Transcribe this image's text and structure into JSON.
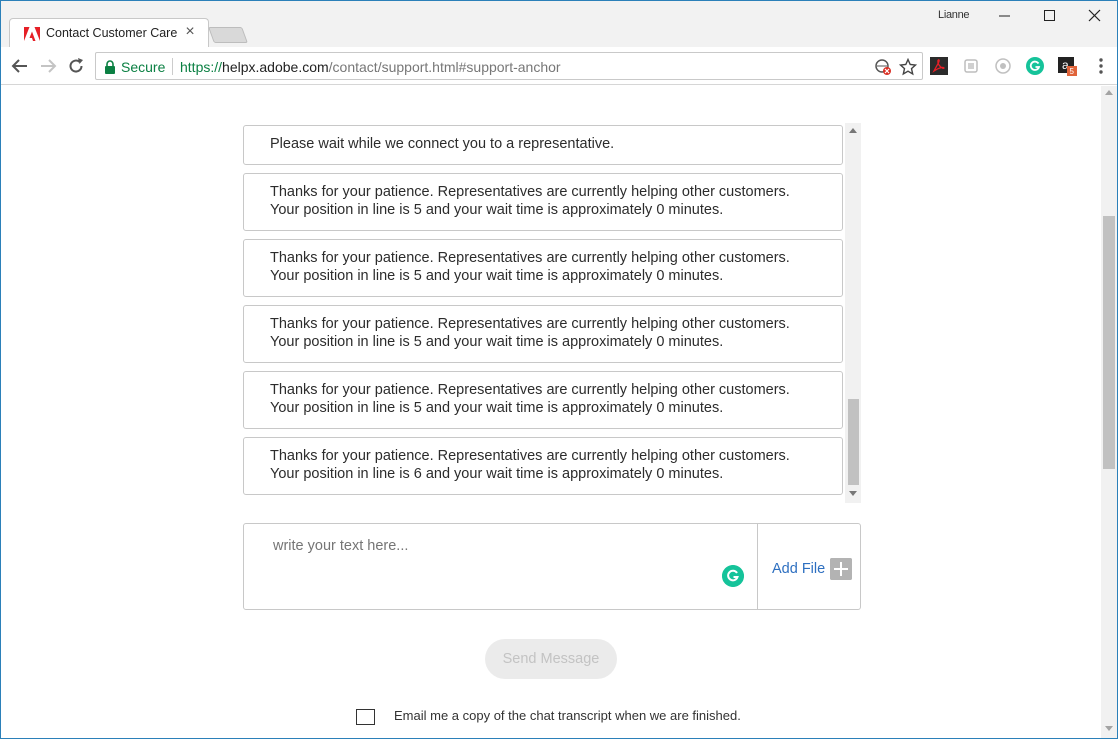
{
  "browser": {
    "tab_title": "Contact Customer Care",
    "profile_name": "Lianne",
    "security_label": "Secure",
    "url_scheme": "https://",
    "url_host": "helpx.adobe.com",
    "url_path": "/contact/support.html#support-anchor",
    "extensions": [
      "adobe-acrobat-icon",
      "extension-grey-icon",
      "extension-eye-icon",
      "grammarly-icon",
      "amazon-icon"
    ],
    "amazon_badge": "5"
  },
  "chat": {
    "messages": [
      {
        "line1": "Please wait while we connect you to a representative.",
        "line2": ""
      },
      {
        "line1": "Thanks for your patience. Representatives are currently helping other customers.",
        "line2": "Your position in line is 5 and your wait time is approximately 0 minutes."
      },
      {
        "line1": "Thanks for your patience. Representatives are currently helping other customers.",
        "line2": "Your position in line is 5 and your wait time is approximately 0 minutes."
      },
      {
        "line1": "Thanks for your patience. Representatives are currently helping other customers.",
        "line2": "Your position in line is 5 and your wait time is approximately 0 minutes."
      },
      {
        "line1": "Thanks for your patience. Representatives are currently helping other customers.",
        "line2": "Your position in line is 5 and your wait time is approximately 0 minutes."
      },
      {
        "line1": "Thanks for your patience. Representatives are currently helping other customers.",
        "line2": "Your position in line is 6 and your wait time is approximately 0 minutes."
      }
    ]
  },
  "compose": {
    "placeholder": "write your text here...",
    "add_file_label": "Add File",
    "send_label": "Send Message",
    "email_transcript_label": "Email me a copy of the chat transcript when we are finished."
  },
  "colors": {
    "secure_green": "#0b8043",
    "link_blue": "#2d6fc0",
    "grammarly_green": "#15c39a",
    "window_border": "#2b80b9"
  }
}
